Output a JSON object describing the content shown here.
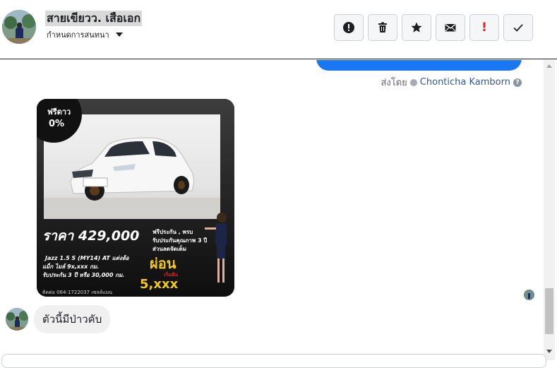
{
  "header": {
    "contact_name": "สายเขียวว. เสือเอก",
    "subtitle": "กำหนดการสนทนา"
  },
  "toolbar": {
    "spam_icon": "exclamation-circle-icon",
    "delete_icon": "trash-icon",
    "star_icon": "star-icon",
    "unread_icon": "envelope-icon",
    "important_label": "!",
    "done_icon": "check-icon"
  },
  "thread": {
    "sent_by_prefix": "ส่งโดย",
    "sent_by_name": "Chonticha Kamborn",
    "sent_by_help": "?",
    "received_message": "ตัวนี้มีป่าวคับ"
  },
  "ad_image": {
    "badge_line1": "ฟรีดาว",
    "badge_line2": "0%",
    "price": "ราคา 429,000",
    "features": [
      "ฟรีประกัน , พรบ",
      "รับประกันคุณภาพ 3 ปี",
      "ส่วนลดจัดเต็ม"
    ],
    "spec_line1": "Jazz 1.5 S (MY14) AT แต่งล้อ",
    "spec_line2": "แม็ก ไมล์ 9x,xxx กม.",
    "spec_line3": "รับประกัน 3 ปี หรือ 30,000 กม.",
    "installment_label": "ผ่อน",
    "installment_sub": "เริ่มต้น",
    "installment_amount": "5,xxx",
    "contact": "ติดต่อ 064-1722037 เซลล์แมน"
  },
  "colors": {
    "sent_bubble": "#1877f2",
    "received_bubble": "#f0f0f0",
    "sender_link": "#385898",
    "ad_yellow": "#f2c81a"
  }
}
